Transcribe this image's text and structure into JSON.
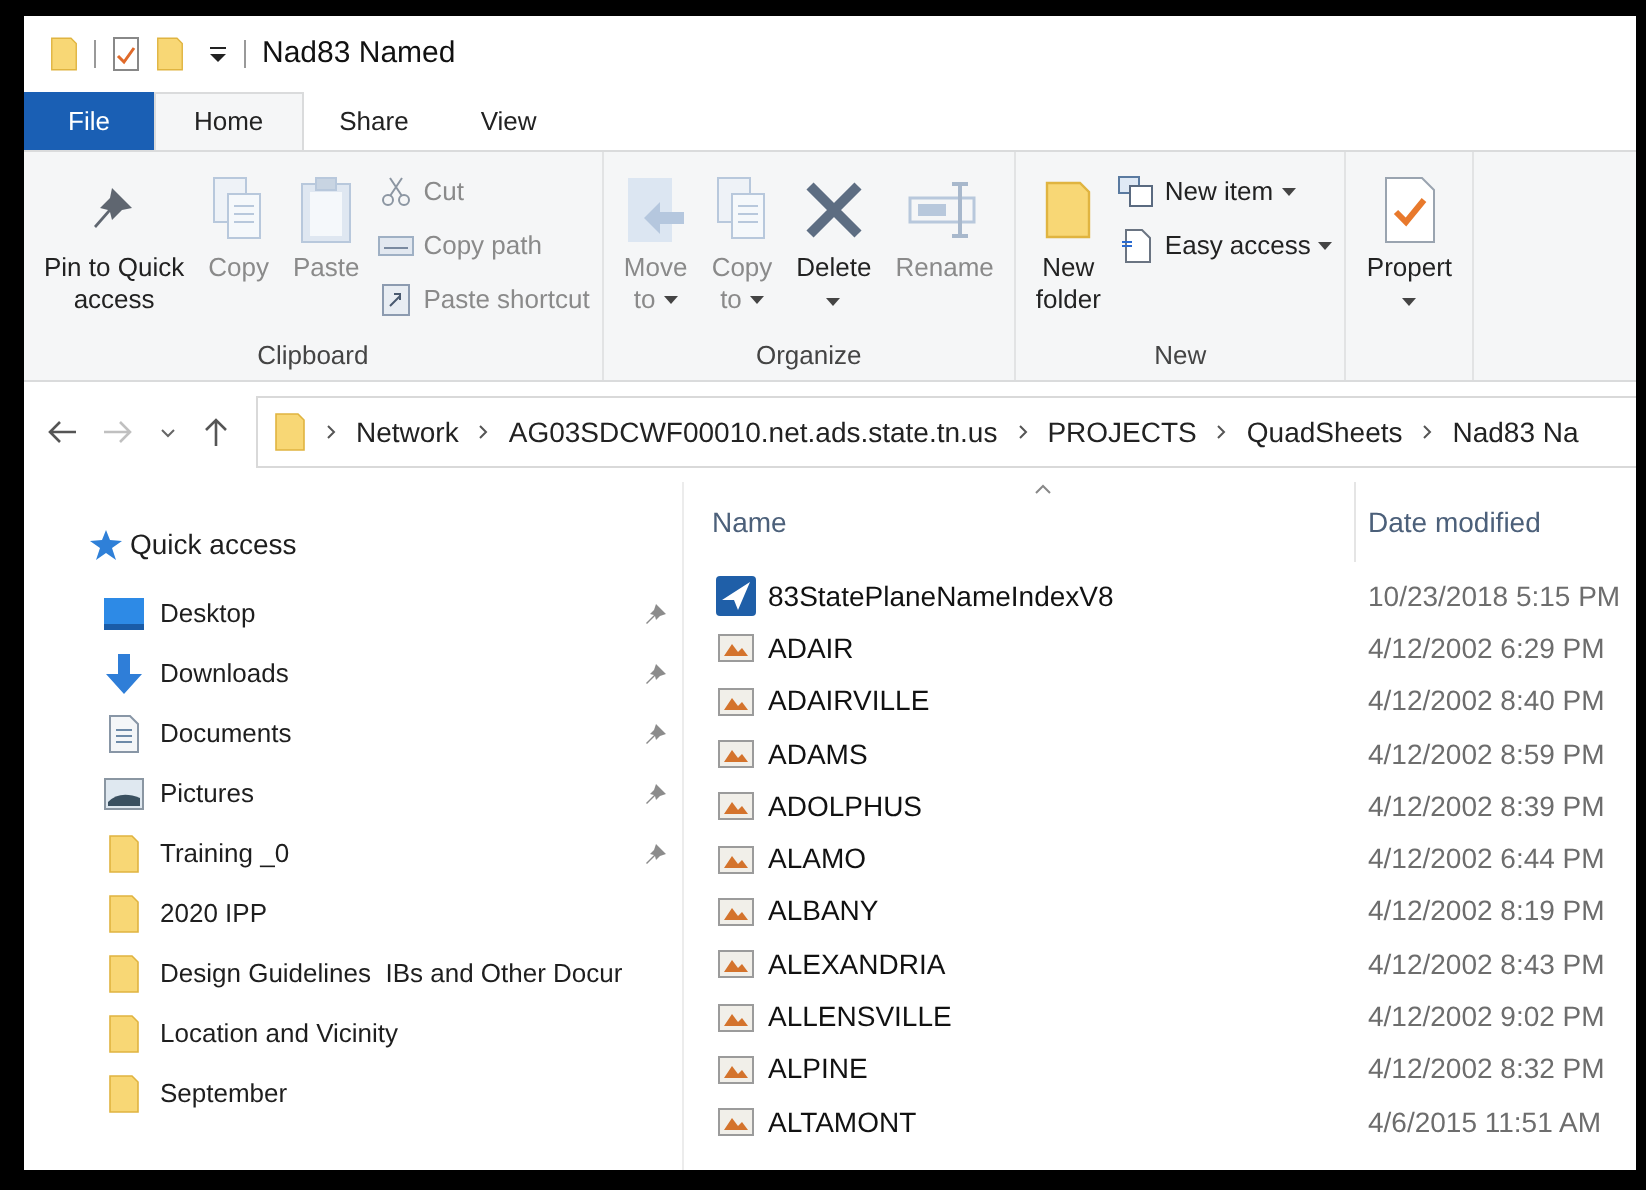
{
  "window": {
    "title": "Nad83 Named"
  },
  "tabs": [
    {
      "label": "File",
      "kind": "file",
      "selected": false
    },
    {
      "label": "Home",
      "kind": "tab",
      "selected": true
    },
    {
      "label": "Share",
      "kind": "tab",
      "selected": false
    },
    {
      "label": "View",
      "kind": "tab",
      "selected": false
    }
  ],
  "ribbon": {
    "groups": [
      {
        "label": "Clipboard",
        "buttons": [
          {
            "kind": "large",
            "label": "Pin to Quick access",
            "disabled": false
          },
          {
            "kind": "large",
            "label": "Copy",
            "disabled": true
          },
          {
            "kind": "large",
            "label": "Paste",
            "disabled": true
          },
          {
            "kind": "stack",
            "items": [
              {
                "label": "Cut",
                "disabled": true
              },
              {
                "label": "Copy path",
                "disabled": true
              },
              {
                "label": "Paste shortcut",
                "disabled": true
              }
            ]
          }
        ]
      },
      {
        "label": "Organize",
        "buttons": [
          {
            "kind": "large",
            "label": "Move to",
            "disabled": true,
            "dropdown": true
          },
          {
            "kind": "large",
            "label": "Copy to",
            "disabled": true,
            "dropdown": true
          },
          {
            "kind": "large",
            "label": "Delete",
            "disabled": false,
            "dropdown": true
          },
          {
            "kind": "large",
            "label": "Rename",
            "disabled": true
          }
        ]
      },
      {
        "label": "New",
        "buttons": [
          {
            "kind": "large",
            "label": "New folder",
            "disabled": false
          },
          {
            "kind": "stack",
            "items": [
              {
                "label": "New item",
                "disabled": false,
                "dropdown": true
              },
              {
                "label": "Easy access",
                "disabled": false,
                "dropdown": true
              }
            ]
          }
        ]
      },
      {
        "buttons": [
          {
            "kind": "large",
            "label": "Propert",
            "disabled": false,
            "dropdown": true
          }
        ]
      }
    ]
  },
  "address_bar": {
    "path": [
      "Network",
      "AG03SDCWF00010.net.ads.state.tn.us",
      "PROJECTS",
      "QuadSheets",
      "Nad83 Na"
    ]
  },
  "sidebar": {
    "header": "Quick access",
    "items": [
      {
        "label": "Desktop",
        "kind": "desktop",
        "pinned": true
      },
      {
        "label": "Downloads",
        "kind": "downloads",
        "pinned": true
      },
      {
        "label": "Documents",
        "kind": "documents",
        "pinned": true
      },
      {
        "label": "Pictures",
        "kind": "pictures",
        "pinned": true
      },
      {
        "label": "Training _0",
        "kind": "folder",
        "pinned": true
      },
      {
        "label": "2020 IPP",
        "kind": "folder",
        "pinned": false
      },
      {
        "label": "Design Guidelines  IBs and Other Docur",
        "kind": "folder",
        "pinned": false
      },
      {
        "label": "Location and Vicinity",
        "kind": "folder",
        "pinned": false
      },
      {
        "label": "September",
        "kind": "folder",
        "pinned": false
      }
    ]
  },
  "file_list": {
    "columns": [
      "Name",
      "Date modified"
    ],
    "rows": [
      {
        "name": "83StatePlaneNameIndexV8",
        "date": "10/23/2018 5:15 PM",
        "kind": "app"
      },
      {
        "name": "ADAIR",
        "date": "4/12/2002 6:29 PM",
        "kind": "image"
      },
      {
        "name": "ADAIRVILLE",
        "date": "4/12/2002 8:40 PM",
        "kind": "image"
      },
      {
        "name": "ADAMS",
        "date": "4/12/2002 8:59 PM",
        "kind": "image"
      },
      {
        "name": "ADOLPHUS",
        "date": "4/12/2002 8:39 PM",
        "kind": "image"
      },
      {
        "name": "ALAMO",
        "date": "4/12/2002 6:44 PM",
        "kind": "image"
      },
      {
        "name": "ALBANY",
        "date": "4/12/2002 8:19 PM",
        "kind": "image"
      },
      {
        "name": "ALEXANDRIA",
        "date": "4/12/2002 8:43 PM",
        "kind": "image"
      },
      {
        "name": "ALLENSVILLE",
        "date": "4/12/2002 9:02 PM",
        "kind": "image"
      },
      {
        "name": "ALPINE",
        "date": "4/12/2002 8:32 PM",
        "kind": "image"
      },
      {
        "name": "ALTAMONT",
        "date": "4/6/2015 11:51 AM",
        "kind": "image"
      }
    ]
  }
}
